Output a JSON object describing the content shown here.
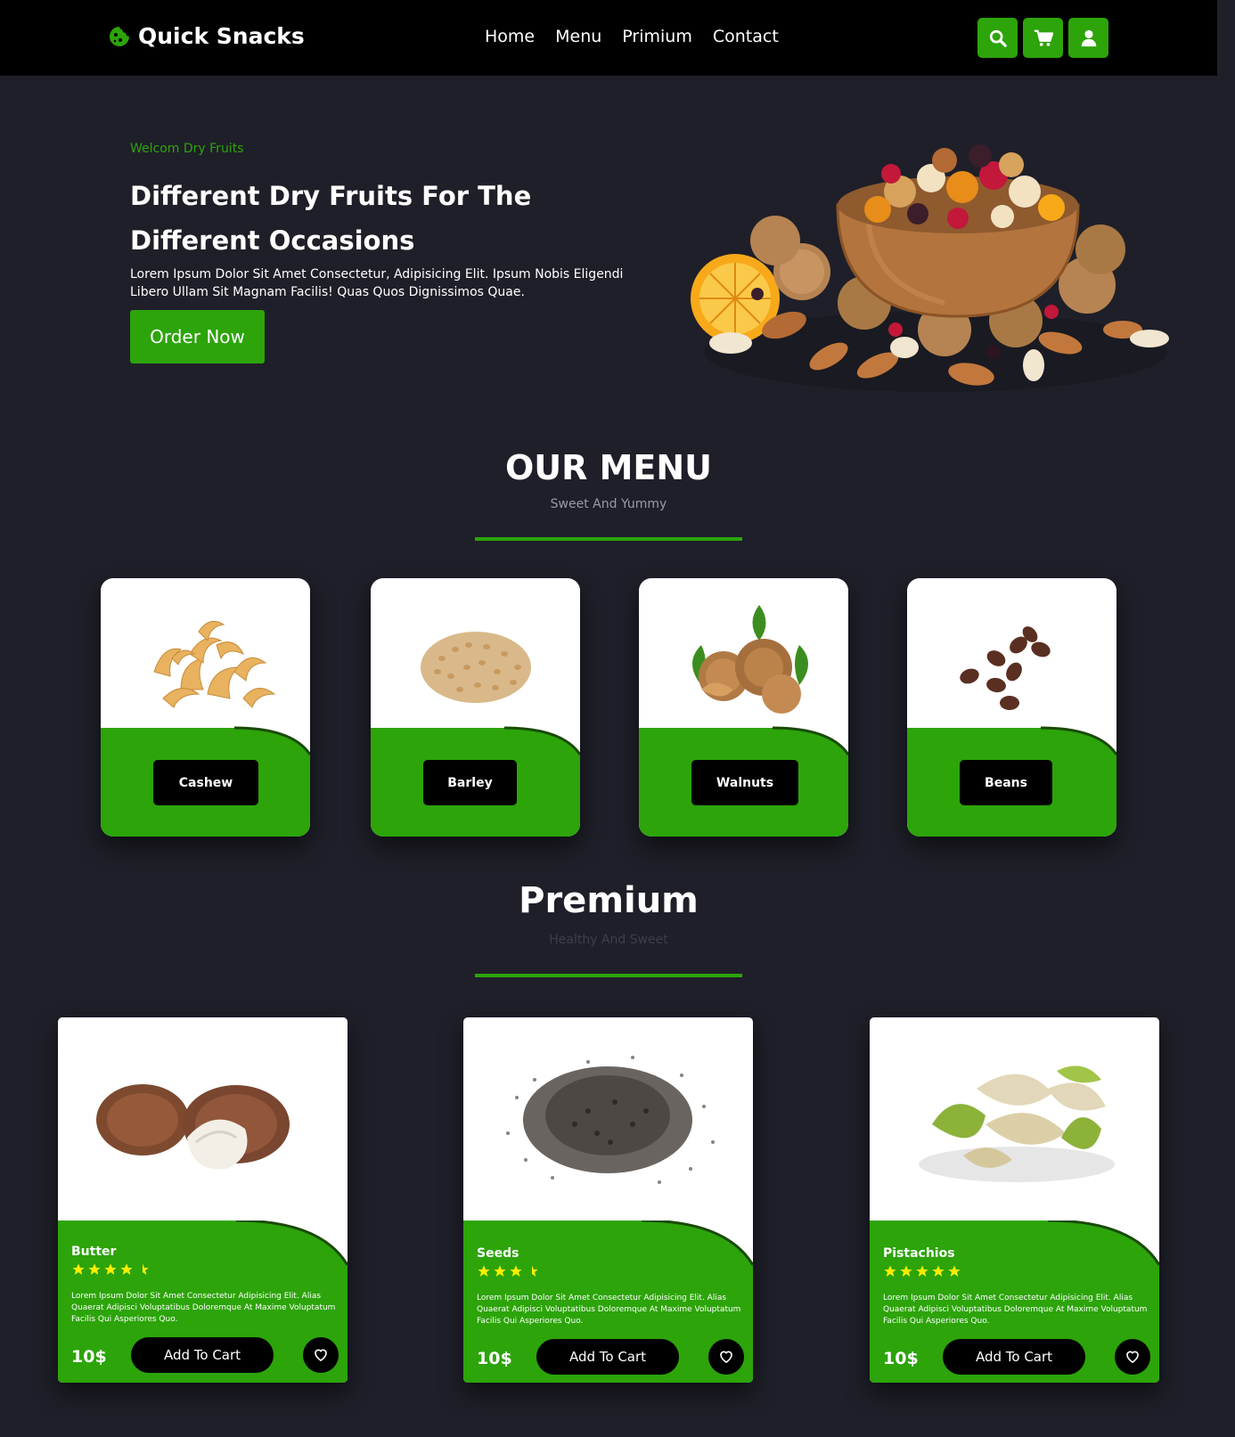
{
  "header": {
    "brand": "Quick Snacks",
    "brand_icon": "cookie-icon",
    "nav": [
      "Home",
      "Menu",
      "Primium",
      "Contact"
    ],
    "icons": [
      "search-icon",
      "cart-icon",
      "user-icon"
    ]
  },
  "hero": {
    "eyebrow": "Welcom Dry Fruits",
    "title_line1": "Different Dry Fruits For The",
    "title_line2": "Different Occasions",
    "text": "Lorem Ipsum Dolor Sit Amet Consectetur, Adipisicing Elit. Ipsum Nobis Eligendi Libero Ullam Sit Magnam Facilis! Quas Quos Dignissimos Quae.",
    "button": "Order Now"
  },
  "menu": {
    "title": "OUR MENU",
    "subtitle": "Sweet And Yummy",
    "items": [
      {
        "label": "Cashew"
      },
      {
        "label": "Barley"
      },
      {
        "label": "Walnuts"
      },
      {
        "label": "Beans"
      }
    ]
  },
  "premium": {
    "title": "Premium",
    "subtitle": "Healthy And Sweet",
    "items": [
      {
        "name": "Butter",
        "rating": 4.5,
        "desc": "Lorem Ipsum Dolor Sit Amet Consectetur Adipisicing Elit. Alias Quaerat Adipisci Voluptatibus Doloremque At Maxime Voluptatum Facilis Qui Asperiores Quo.",
        "price": "10$",
        "button": "Add To Cart"
      },
      {
        "name": "Seeds",
        "rating": 3.5,
        "desc": "Lorem Ipsum Dolor Sit Amet Consectetur Adipisicing Elit. Alias Quaerat Adipisci Voluptatibus Doloremque At Maxime Voluptatum Facilis Qui Asperiores Quo.",
        "price": "10$",
        "button": "Add To Cart"
      },
      {
        "name": "Pistachios",
        "rating": 5,
        "desc": "Lorem Ipsum Dolor Sit Amet Consectetur Adipisicing Elit. Alias Quaerat Adipisci Voluptatibus Doloremque At Maxime Voluptatum Facilis Qui Asperiores Quo.",
        "price": "10$",
        "button": "Add To Cart"
      }
    ]
  },
  "colors": {
    "accent": "#2ca40a",
    "background": "#1f1f29",
    "header": "#000000",
    "star": "#ffee00"
  }
}
